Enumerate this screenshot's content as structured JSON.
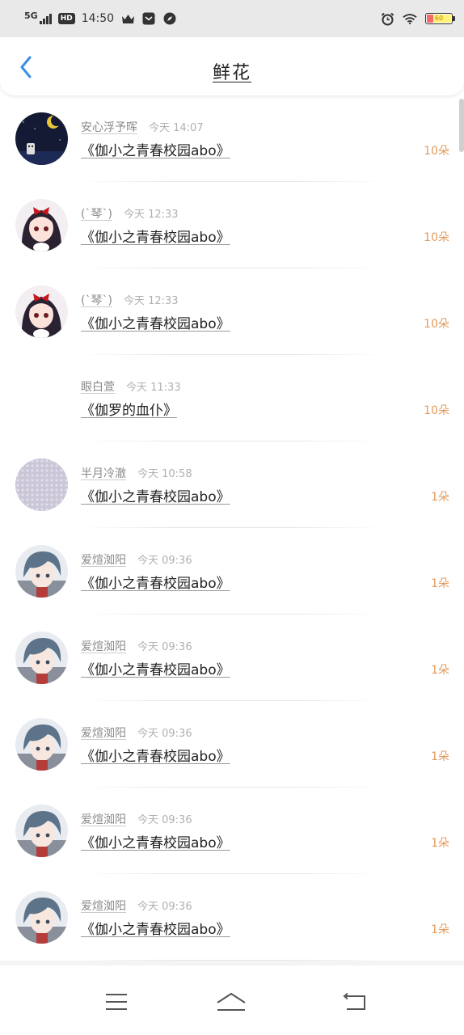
{
  "status_bar": {
    "network": "5G",
    "hd": "HD",
    "time": "14:50",
    "battery": "60"
  },
  "header": {
    "title": "鲜花"
  },
  "items": [
    {
      "name": "安心浮予晖",
      "when": "今天 14:07",
      "book": "《伽小之青春校园abo》",
      "gift": "10朵",
      "avatar": "moon-night"
    },
    {
      "name": "(`琴`)",
      "when": "今天 12:33",
      "book": "《伽小之青春校园abo》",
      "gift": "10朵",
      "avatar": "anime-girl-bow"
    },
    {
      "name": "(`琴`)",
      "when": "今天 12:33",
      "book": "《伽小之青春校园abo》",
      "gift": "10朵",
      "avatar": "anime-girl-bow"
    },
    {
      "name": "眼白萱",
      "when": "今天 11:33",
      "book": "《伽罗的血仆》",
      "gift": "10朵",
      "avatar": "none"
    },
    {
      "name": "半月冷澈",
      "when": "今天 10:58",
      "book": "《伽小之青春校园abo》",
      "gift": "1朵",
      "avatar": "sparkle"
    },
    {
      "name": "爱煊洳阳",
      "when": "今天 09:36",
      "book": "《伽小之青春校园abo》",
      "gift": "1朵",
      "avatar": "anime-boy"
    },
    {
      "name": "爱煊洳阳",
      "when": "今天 09:36",
      "book": "《伽小之青春校园abo》",
      "gift": "1朵",
      "avatar": "anime-boy"
    },
    {
      "name": "爱煊洳阳",
      "when": "今天 09:36",
      "book": "《伽小之青春校园abo》",
      "gift": "1朵",
      "avatar": "anime-boy"
    },
    {
      "name": "爱煊洳阳",
      "when": "今天 09:36",
      "book": "《伽小之青春校园abo》",
      "gift": "1朵",
      "avatar": "anime-boy"
    },
    {
      "name": "爱煊洳阳",
      "when": "今天 09:36",
      "book": "《伽小之青春校园abo》",
      "gift": "1朵",
      "avatar": "anime-boy"
    }
  ],
  "colors": {
    "accent_blue": "#3a8ee6",
    "gift_orange": "#e59a5c",
    "status_bg": "#e9e9e9"
  },
  "icons": {
    "back": "chevron-left-icon",
    "nav_menu": "menu-icon",
    "nav_home": "home-icon",
    "nav_back": "return-icon"
  }
}
